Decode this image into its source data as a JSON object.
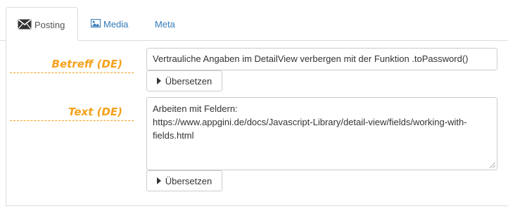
{
  "tabs": {
    "posting": {
      "label": "Posting",
      "icon": "envelope-icon"
    },
    "media": {
      "label": "Media",
      "icon": "image-icon"
    },
    "meta": {
      "label": "Meta"
    }
  },
  "fields": {
    "betreff": {
      "label": "Betreff (DE)",
      "value": "Vertrauliche Angaben im DetailView verbergen mit der Funktion .toPassword()",
      "translate_button": "Übersetzen"
    },
    "text": {
      "label": "Text (DE)",
      "value_line1": "Arbeiten mit Feldern:",
      "value_line2": "https://www.appgini.de/docs/Javascript-Library/detail-view/fields/working-with-",
      "value_line3": "fields.html",
      "translate_button": "Übersetzen"
    }
  },
  "colors": {
    "label_accent": "#f5a11b",
    "link": "#337ab7"
  }
}
